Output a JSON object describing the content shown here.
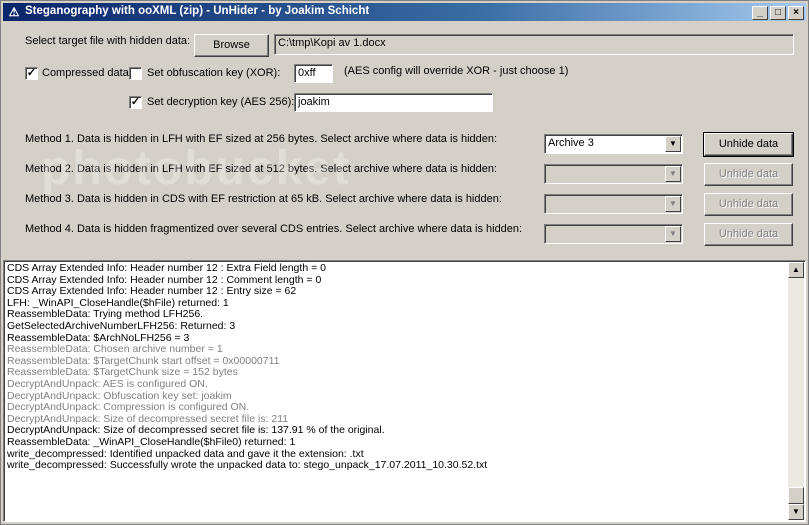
{
  "window": {
    "title": "Steganography with ooXML (zip) - UnHider - by Joakim Schicht",
    "controls": {
      "minimize": "_",
      "maximize": "□",
      "close": "×"
    }
  },
  "target": {
    "label": "Select target file with hidden data:",
    "browse_label": "Browse",
    "path": "C:\\tmp\\Kopi av 1.docx"
  },
  "options": {
    "compressed_label": "Compressed data",
    "compressed_checked": true,
    "obfuscation_label": "Set obfuscation key (XOR):",
    "obfuscation_checked": false,
    "xor_value": "0xff",
    "aes_note": "(AES config will override XOR - just choose 1)",
    "decryption_label": "Set decryption key (AES 256):",
    "decryption_checked": true,
    "aes_key": "joakim"
  },
  "methods": [
    {
      "label": "Method 1. Data is hidden in LFH with EF sized at 256 bytes. Select archive where data is hidden:",
      "selected": "Archive  3",
      "enabled": true,
      "button": "Unhide data"
    },
    {
      "label": "Method 2. Data is hidden in LFH with EF sized at 512 bytes. Select archive where data is hidden:",
      "selected": "",
      "enabled": false,
      "button": "Unhide data"
    },
    {
      "label": "Method 3. Data is hidden in CDS with EF restriction at 65 kB. Select archive where data is hidden:",
      "selected": "",
      "enabled": false,
      "button": "Unhide data"
    },
    {
      "label": "Method 4. Data is hidden fragmentized over several CDS entries. Select archive where data is hidden:",
      "selected": "",
      "enabled": false,
      "button": "Unhide data"
    }
  ],
  "log": {
    "lines": [
      {
        "text": "CDS Array Extended Info: Header number 12 : Extra Field length = 0",
        "grey": false
      },
      {
        "text": "CDS Array Extended Info: Header number 12 : Comment length = 0",
        "grey": false
      },
      {
        "text": "CDS Array Extended Info: Header number 12 : Entry size = 62",
        "grey": false
      },
      {
        "text": "LFH: _WinAPI_CloseHandle($hFile) returned: 1",
        "grey": false
      },
      {
        "text": "ReassembleData: Trying method LFH256.",
        "grey": false
      },
      {
        "text": "GetSelectedArchiveNumberLFH256: Returned: 3",
        "grey": false
      },
      {
        "text": "ReassembleData: $ArchNoLFH256 = 3",
        "grey": false
      },
      {
        "text": "ReassembleData: Chosen archive number = 1",
        "grey": true
      },
      {
        "text": "ReassembleData: $TargetChunk start offset = 0x00000711",
        "grey": true
      },
      {
        "text": "ReassembleData: $TargetChunk size = 152 bytes",
        "grey": true
      },
      {
        "text": "DecryptAndUnpack: AES is configured ON.",
        "grey": true
      },
      {
        "text": "DecryptAndUnpack: Obfuscation key set: joakim",
        "grey": true
      },
      {
        "text": "DecryptAndUnpack: Compression is configured ON.",
        "grey": true
      },
      {
        "text": "DecryptAndUnpack: Size of decompressed secret file is: 211",
        "grey": true
      },
      {
        "text": "DecryptAndUnpack: Size of decompressed secret file is: 137.91 % of the original.",
        "grey": false
      },
      {
        "text": "ReassembleData: _WinAPI_CloseHandle($hFile0) returned: 1",
        "grey": false
      },
      {
        "text": "write_decompressed: Identified unpacked data and gave it the extension: .txt",
        "grey": false
      },
      {
        "text": "write_decompressed: Successfully wrote the unpacked data to: stego_unpack_17.07.2011_10.30.52.txt",
        "grey": false
      }
    ]
  },
  "watermark": "photobucket",
  "icons": {
    "app": "app-icon",
    "dropdown": "chevron-down-icon",
    "scroll_up": "arrow-up-icon",
    "scroll_down": "arrow-down-icon"
  }
}
